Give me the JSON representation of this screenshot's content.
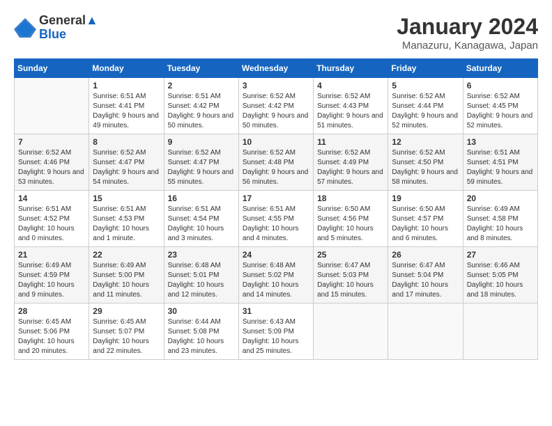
{
  "header": {
    "logo_line1": "General",
    "logo_line2": "Blue",
    "month": "January 2024",
    "location": "Manazuru, Kanagawa, Japan"
  },
  "weekdays": [
    "Sunday",
    "Monday",
    "Tuesday",
    "Wednesday",
    "Thursday",
    "Friday",
    "Saturday"
  ],
  "weeks": [
    [
      {
        "day": "",
        "sunrise": "",
        "sunset": "",
        "daylight": ""
      },
      {
        "day": "1",
        "sunrise": "Sunrise: 6:51 AM",
        "sunset": "Sunset: 4:41 PM",
        "daylight": "Daylight: 9 hours and 49 minutes."
      },
      {
        "day": "2",
        "sunrise": "Sunrise: 6:51 AM",
        "sunset": "Sunset: 4:42 PM",
        "daylight": "Daylight: 9 hours and 50 minutes."
      },
      {
        "day": "3",
        "sunrise": "Sunrise: 6:52 AM",
        "sunset": "Sunset: 4:42 PM",
        "daylight": "Daylight: 9 hours and 50 minutes."
      },
      {
        "day": "4",
        "sunrise": "Sunrise: 6:52 AM",
        "sunset": "Sunset: 4:43 PM",
        "daylight": "Daylight: 9 hours and 51 minutes."
      },
      {
        "day": "5",
        "sunrise": "Sunrise: 6:52 AM",
        "sunset": "Sunset: 4:44 PM",
        "daylight": "Daylight: 9 hours and 52 minutes."
      },
      {
        "day": "6",
        "sunrise": "Sunrise: 6:52 AM",
        "sunset": "Sunset: 4:45 PM",
        "daylight": "Daylight: 9 hours and 52 minutes."
      }
    ],
    [
      {
        "day": "7",
        "sunrise": "Sunrise: 6:52 AM",
        "sunset": "Sunset: 4:46 PM",
        "daylight": "Daylight: 9 hours and 53 minutes."
      },
      {
        "day": "8",
        "sunrise": "Sunrise: 6:52 AM",
        "sunset": "Sunset: 4:47 PM",
        "daylight": "Daylight: 9 hours and 54 minutes."
      },
      {
        "day": "9",
        "sunrise": "Sunrise: 6:52 AM",
        "sunset": "Sunset: 4:47 PM",
        "daylight": "Daylight: 9 hours and 55 minutes."
      },
      {
        "day": "10",
        "sunrise": "Sunrise: 6:52 AM",
        "sunset": "Sunset: 4:48 PM",
        "daylight": "Daylight: 9 hours and 56 minutes."
      },
      {
        "day": "11",
        "sunrise": "Sunrise: 6:52 AM",
        "sunset": "Sunset: 4:49 PM",
        "daylight": "Daylight: 9 hours and 57 minutes."
      },
      {
        "day": "12",
        "sunrise": "Sunrise: 6:52 AM",
        "sunset": "Sunset: 4:50 PM",
        "daylight": "Daylight: 9 hours and 58 minutes."
      },
      {
        "day": "13",
        "sunrise": "Sunrise: 6:51 AM",
        "sunset": "Sunset: 4:51 PM",
        "daylight": "Daylight: 9 hours and 59 minutes."
      }
    ],
    [
      {
        "day": "14",
        "sunrise": "Sunrise: 6:51 AM",
        "sunset": "Sunset: 4:52 PM",
        "daylight": "Daylight: 10 hours and 0 minutes."
      },
      {
        "day": "15",
        "sunrise": "Sunrise: 6:51 AM",
        "sunset": "Sunset: 4:53 PM",
        "daylight": "Daylight: 10 hours and 1 minute."
      },
      {
        "day": "16",
        "sunrise": "Sunrise: 6:51 AM",
        "sunset": "Sunset: 4:54 PM",
        "daylight": "Daylight: 10 hours and 3 minutes."
      },
      {
        "day": "17",
        "sunrise": "Sunrise: 6:51 AM",
        "sunset": "Sunset: 4:55 PM",
        "daylight": "Daylight: 10 hours and 4 minutes."
      },
      {
        "day": "18",
        "sunrise": "Sunrise: 6:50 AM",
        "sunset": "Sunset: 4:56 PM",
        "daylight": "Daylight: 10 hours and 5 minutes."
      },
      {
        "day": "19",
        "sunrise": "Sunrise: 6:50 AM",
        "sunset": "Sunset: 4:57 PM",
        "daylight": "Daylight: 10 hours and 6 minutes."
      },
      {
        "day": "20",
        "sunrise": "Sunrise: 6:49 AM",
        "sunset": "Sunset: 4:58 PM",
        "daylight": "Daylight: 10 hours and 8 minutes."
      }
    ],
    [
      {
        "day": "21",
        "sunrise": "Sunrise: 6:49 AM",
        "sunset": "Sunset: 4:59 PM",
        "daylight": "Daylight: 10 hours and 9 minutes."
      },
      {
        "day": "22",
        "sunrise": "Sunrise: 6:49 AM",
        "sunset": "Sunset: 5:00 PM",
        "daylight": "Daylight: 10 hours and 11 minutes."
      },
      {
        "day": "23",
        "sunrise": "Sunrise: 6:48 AM",
        "sunset": "Sunset: 5:01 PM",
        "daylight": "Daylight: 10 hours and 12 minutes."
      },
      {
        "day": "24",
        "sunrise": "Sunrise: 6:48 AM",
        "sunset": "Sunset: 5:02 PM",
        "daylight": "Daylight: 10 hours and 14 minutes."
      },
      {
        "day": "25",
        "sunrise": "Sunrise: 6:47 AM",
        "sunset": "Sunset: 5:03 PM",
        "daylight": "Daylight: 10 hours and 15 minutes."
      },
      {
        "day": "26",
        "sunrise": "Sunrise: 6:47 AM",
        "sunset": "Sunset: 5:04 PM",
        "daylight": "Daylight: 10 hours and 17 minutes."
      },
      {
        "day": "27",
        "sunrise": "Sunrise: 6:46 AM",
        "sunset": "Sunset: 5:05 PM",
        "daylight": "Daylight: 10 hours and 18 minutes."
      }
    ],
    [
      {
        "day": "28",
        "sunrise": "Sunrise: 6:45 AM",
        "sunset": "Sunset: 5:06 PM",
        "daylight": "Daylight: 10 hours and 20 minutes."
      },
      {
        "day": "29",
        "sunrise": "Sunrise: 6:45 AM",
        "sunset": "Sunset: 5:07 PM",
        "daylight": "Daylight: 10 hours and 22 minutes."
      },
      {
        "day": "30",
        "sunrise": "Sunrise: 6:44 AM",
        "sunset": "Sunset: 5:08 PM",
        "daylight": "Daylight: 10 hours and 23 minutes."
      },
      {
        "day": "31",
        "sunrise": "Sunrise: 6:43 AM",
        "sunset": "Sunset: 5:09 PM",
        "daylight": "Daylight: 10 hours and 25 minutes."
      },
      {
        "day": "",
        "sunrise": "",
        "sunset": "",
        "daylight": ""
      },
      {
        "day": "",
        "sunrise": "",
        "sunset": "",
        "daylight": ""
      },
      {
        "day": "",
        "sunrise": "",
        "sunset": "",
        "daylight": ""
      }
    ]
  ]
}
